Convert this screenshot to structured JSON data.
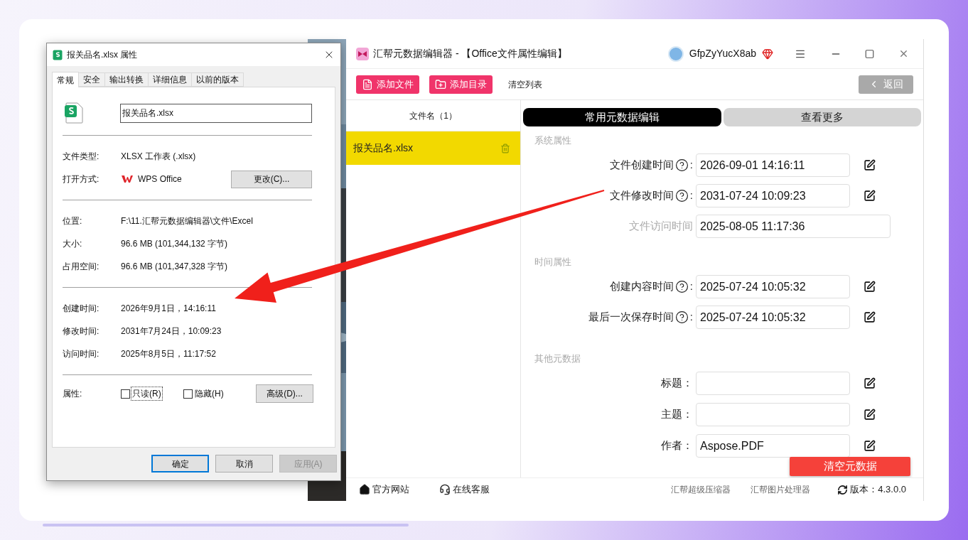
{
  "properties_dialog": {
    "title": "报关品名.xlsx 属性",
    "tabs": [
      {
        "label": "常规",
        "selected": true
      },
      {
        "label": "安全",
        "selected": false
      },
      {
        "label": "输出转换",
        "selected": false
      },
      {
        "label": "详细信息",
        "selected": false
      },
      {
        "label": "以前的版本",
        "selected": false
      }
    ],
    "file_name": "报关品名.xlsx",
    "info_groups": [
      {
        "rows": [
          {
            "kind": "text",
            "label": "文件类型:",
            "value": "XLSX 工作表 (.xlsx)"
          },
          {
            "kind": "app",
            "label": "打开方式:",
            "value": "WPS Office",
            "button": "更改(C)..."
          }
        ]
      },
      {
        "rows": [
          {
            "kind": "text",
            "label": "位置:",
            "value": "F:\\11.汇帮元数据编辑器\\文件\\Excel"
          },
          {
            "kind": "text",
            "label": "大小:",
            "value": "96.6 MB (101,344,132 字节)"
          },
          {
            "kind": "text",
            "label": "占用空间:",
            "value": "96.6 MB (101,347,328 字节)"
          }
        ]
      },
      {
        "rows": [
          {
            "kind": "text",
            "label": "创建时间:",
            "value": "2026年9月1日，14:16:11"
          },
          {
            "kind": "text",
            "label": "修改时间:",
            "value": "2031年7月24日，10:09:23"
          },
          {
            "kind": "text",
            "label": "访问时间:",
            "value": "2025年8月5日，11:17:52"
          }
        ]
      }
    ],
    "attributes": {
      "label": "属性:",
      "checkboxes": [
        {
          "label": "只读(R)",
          "checked": false,
          "focused": true
        },
        {
          "label": "隐藏(H)",
          "checked": false,
          "focused": false
        }
      ],
      "button": "高级(D)..."
    },
    "buttons": [
      {
        "label": "确定",
        "default": true,
        "disabled": false
      },
      {
        "label": "取消",
        "default": false,
        "disabled": false
      },
      {
        "label": "应用(A)",
        "default": false,
        "disabled": true
      }
    ]
  },
  "app_window": {
    "title": "汇帮元数据编辑器 - 【Office文件属性编辑】",
    "user": "GfpZyYucX8ab",
    "toolbar": [
      {
        "kind": "add-file",
        "label": "添加文件"
      },
      {
        "kind": "add-folder",
        "label": "添加目录"
      }
    ],
    "clear_list": "清空列表",
    "back": "返回",
    "file_list": {
      "header": "文件名（1）",
      "files": [
        {
          "name": "报关品名.xlsx",
          "selected": true
        }
      ]
    },
    "tabs": [
      {
        "label": "常用元数据编辑",
        "selected": true
      },
      {
        "label": "查看更多",
        "selected": false
      }
    ],
    "sections": [
      {
        "title": "系统属性",
        "fields": [
          {
            "label": "文件创建时间",
            "help": true,
            "sep": ":",
            "value": "2026-09-01 14:16:11",
            "editable": true
          },
          {
            "label": "文件修改时间",
            "help": true,
            "sep": ":",
            "value": "2031-07-24 10:09:23",
            "editable": true
          },
          {
            "label": "文件访问时间",
            "help": false,
            "value": "2025-08-05 11:17:36",
            "editable": false
          }
        ]
      },
      {
        "title": "时间属性",
        "fields": [
          {
            "label": "创建内容时间",
            "help": true,
            "sep": ":",
            "value": "2025-07-24 10:05:32",
            "editable": true
          },
          {
            "label": "最后一次保存时间",
            "help": true,
            "sep": ":",
            "value": "2025-07-24 10:05:32",
            "editable": true
          }
        ]
      },
      {
        "title": "其他元数据",
        "fields": [
          {
            "label": "标题：",
            "help": false,
            "editable": true
          },
          {
            "label": "主题：",
            "help": false,
            "editable": true
          },
          {
            "label": "作者：",
            "help": false,
            "value": "Aspose.PDF",
            "editable": true
          }
        ]
      }
    ],
    "clear_metadata": "清空元数据",
    "footer": {
      "links": [
        {
          "kind": "home",
          "label": "官方网站"
        },
        {
          "kind": "support",
          "label": "在线客服"
        }
      ],
      "products": [
        "汇帮超级压缩器",
        "汇帮图片处理器"
      ],
      "version": "版本：4.3.0.0"
    }
  }
}
